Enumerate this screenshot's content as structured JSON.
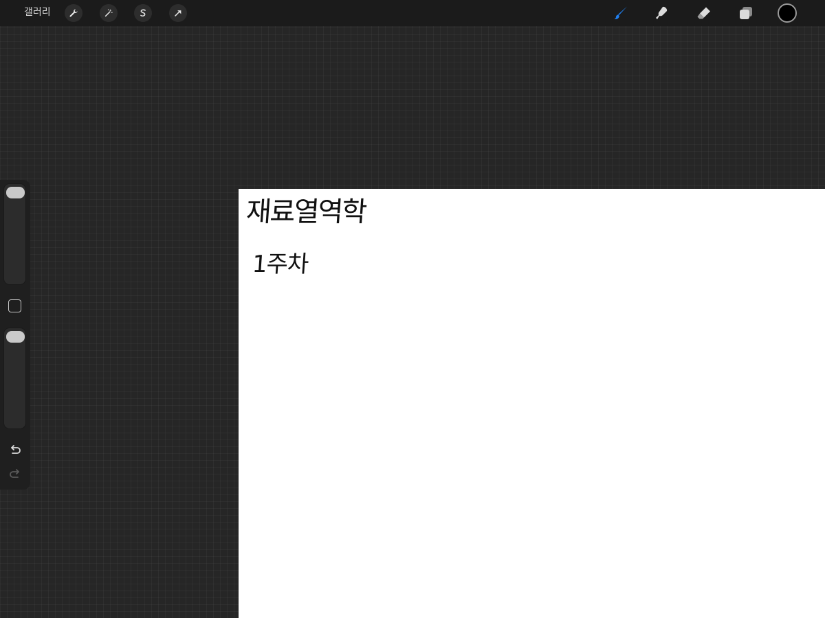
{
  "toolbar": {
    "gallery_label": "갤러리",
    "left_tools": [
      {
        "icon": "wrench-icon"
      },
      {
        "icon": "magic-wand-icon"
      },
      {
        "icon": "selection-icon"
      },
      {
        "icon": "transform-arrow-icon"
      }
    ],
    "right_tools": [
      {
        "icon": "brush-icon",
        "active": true
      },
      {
        "icon": "smudge-icon"
      },
      {
        "icon": "eraser-icon"
      },
      {
        "icon": "layers-icon"
      }
    ],
    "active_color": "#000000",
    "accent_color": "#1f7ff0"
  },
  "sidebar": {
    "brush_size_level": 1.0,
    "opacity_level": 1.0,
    "undo_icon": "undo-icon",
    "redo_icon": "redo-icon"
  },
  "canvas": {
    "background": "#ffffff",
    "handwriting": {
      "title": "재료열역학",
      "subtitle": "1주차"
    }
  }
}
